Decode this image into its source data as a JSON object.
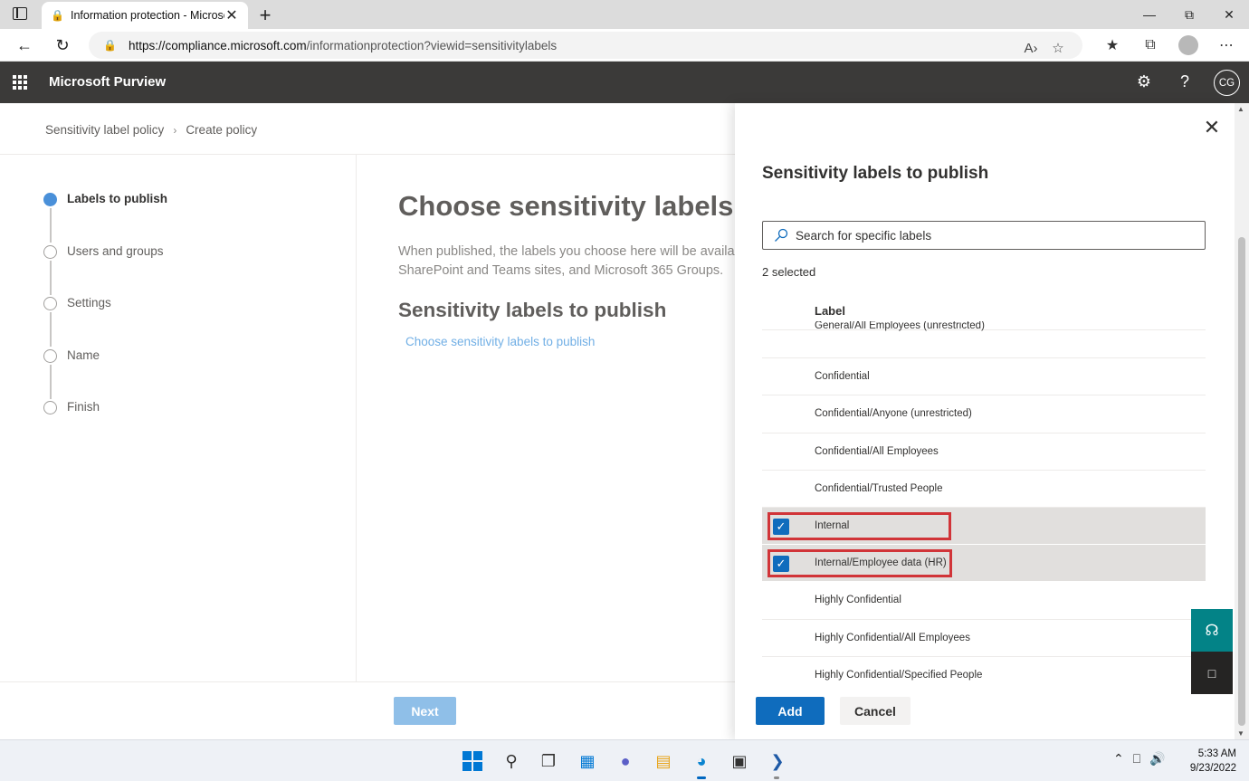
{
  "browser": {
    "tab_title": "Information protection - Microsc",
    "url_host": "https://compliance.microsoft.com",
    "url_path": "/informationprotection?viewid=sensitivitylabels"
  },
  "app": {
    "title": "Microsoft Purview",
    "user_initials": "CG"
  },
  "breadcrumb": {
    "items": [
      "Sensitivity label policy",
      "Create policy"
    ]
  },
  "wizard": {
    "steps": [
      {
        "label": "Labels to publish",
        "active": true
      },
      {
        "label": "Users and groups",
        "active": false
      },
      {
        "label": "Settings",
        "active": false
      },
      {
        "label": "Name",
        "active": false
      },
      {
        "label": "Finish",
        "active": false
      }
    ]
  },
  "main": {
    "heading": "Choose sensitivity labels to publish",
    "description_line1": "When published, the labels you choose here will be available in users' apps and services, such as",
    "description_line2": "SharePoint and Teams sites, and Microsoft 365 Groups.",
    "subheading": "Sensitivity labels to publish",
    "choose_link": "Choose sensitivity labels to publish",
    "next_label": "Next"
  },
  "panel": {
    "title": "Sensitivity labels to publish",
    "search_placeholder": "Search for specific labels",
    "selected_count": "2 selected",
    "column_header": "Label",
    "rows": [
      {
        "label": "General/All Employees (unrestricted)",
        "checked": false
      },
      {
        "label": "Confidential",
        "checked": false
      },
      {
        "label": "Confidential/Anyone (unrestricted)",
        "checked": false
      },
      {
        "label": "Confidential/All Employees",
        "checked": false
      },
      {
        "label": "Confidential/Trusted People",
        "checked": false
      },
      {
        "label": "Internal",
        "checked": true
      },
      {
        "label": "Internal/Employee data (HR)",
        "checked": true
      },
      {
        "label": "Highly Confidential",
        "checked": false
      },
      {
        "label": "Highly Confidential/All Employees",
        "checked": false
      },
      {
        "label": "Highly Confidential/Specified People",
        "checked": false
      }
    ],
    "add_label": "Add",
    "cancel_label": "Cancel"
  },
  "taskbar": {
    "time": "5:33 AM",
    "date": "9/23/2022"
  },
  "colors": {
    "header_bg": "#3b3a39",
    "primary": "#0f6cbd",
    "highlight_border": "#d13438",
    "help_teal": "#038387"
  }
}
